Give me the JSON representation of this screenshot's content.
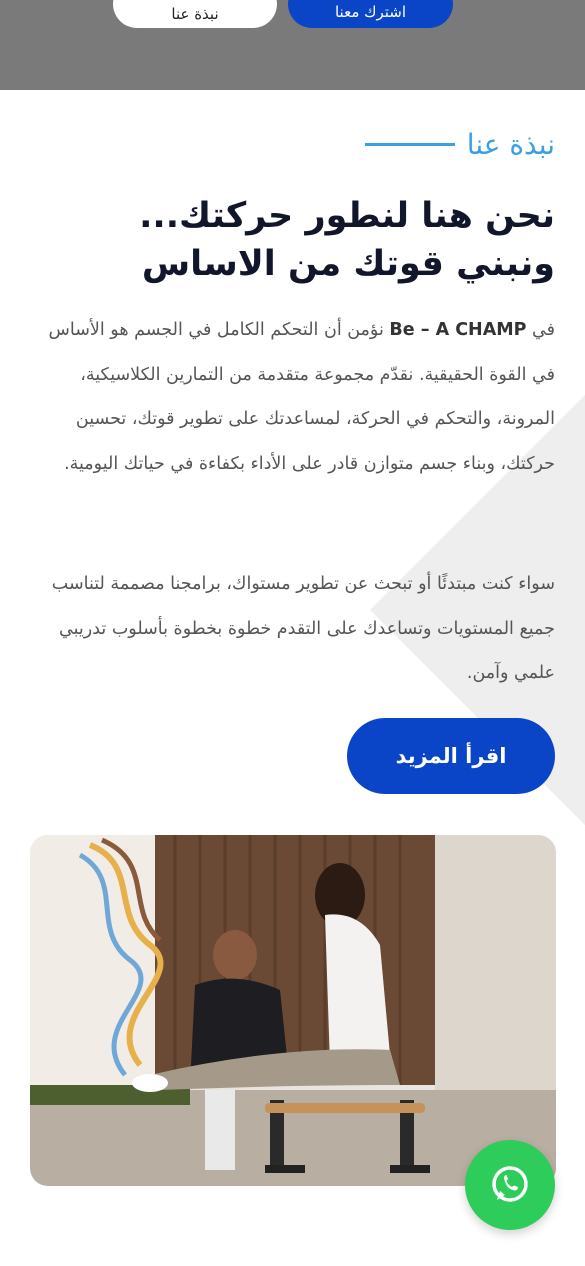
{
  "hero": {
    "about_button": "نبذة عنا",
    "join_button": "اشترك معنا"
  },
  "about": {
    "eyebrow": "نبذة عنا",
    "headline_line1": "نحن هنا لنطور حركتك...",
    "headline_line2": "ونبني قوتك من الاساس",
    "para1_prefix": "في ",
    "brand": "Be – A CHAMP",
    "para1_rest": " نؤمن أن التحكم الكامل في الجسم هو الأساس في القوة الحقيقية. نقدّم مجموعة متقدمة من التمارين الكلاسيكية، المرونة، والتحكم في الحركة، لمساعدتك على تطوير قوتك، تحسين حركتك، وبناء جسم متوازن قادر على الأداء بكفاءة في حياتك اليومية.",
    "para2": "سواء كنت مبتدئًا أو تبحث عن تطوير مستواك، برامجنا مصممة لتناسب جميع المستويات وتساعدك على التقدم خطوة بخطوة بأسلوب تدريبي علمي وآمن.",
    "read_more": "اقرأ المزيد"
  },
  "colors": {
    "accent_blue": "#0a45c8",
    "eyebrow_blue": "#3aa0e2",
    "whatsapp_green": "#2ecc5a"
  },
  "icons": {
    "floating": "whatsapp-icon"
  }
}
